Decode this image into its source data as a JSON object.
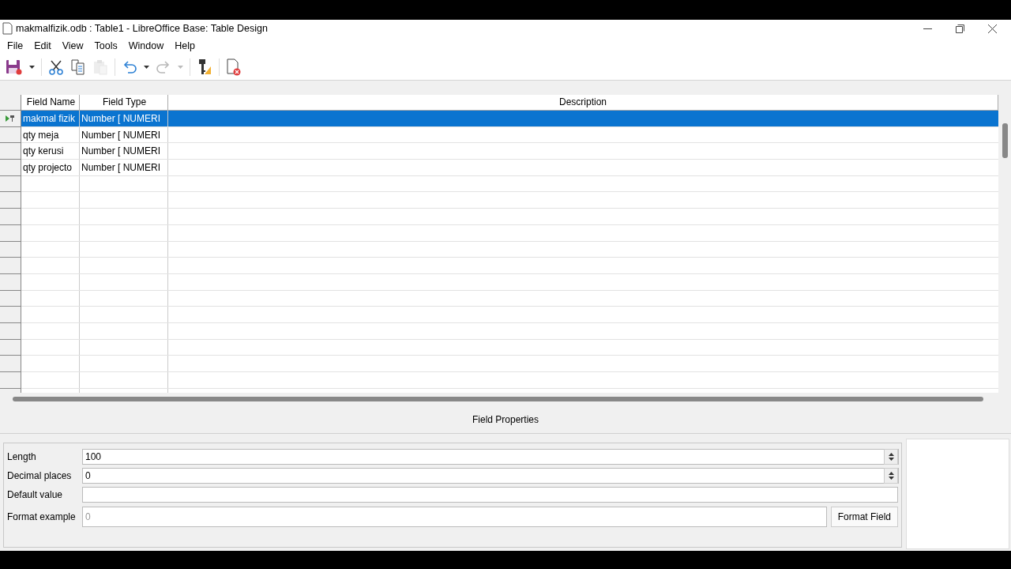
{
  "window": {
    "title": "makmalfizik.odb : Table1 - LibreOffice Base: Table Design"
  },
  "menu": [
    "File",
    "Edit",
    "View",
    "Tools",
    "Window",
    "Help"
  ],
  "toolbar": [
    {
      "kind": "save",
      "disabled": false,
      "dropdown": true
    },
    {
      "kind": "cut",
      "disabled": false,
      "dropdown": false
    },
    {
      "kind": "copy",
      "disabled": false,
      "dropdown": false
    },
    {
      "kind": "paste",
      "disabled": true,
      "dropdown": false
    },
    {
      "kind": "undo",
      "disabled": false,
      "dropdown": true
    },
    {
      "kind": "redo",
      "disabled": true,
      "dropdown": true
    },
    {
      "kind": "key",
      "disabled": false,
      "dropdown": false
    },
    {
      "kind": "close",
      "disabled": false,
      "dropdown": false
    }
  ],
  "table": {
    "columns": [
      "Field Name",
      "Field Type",
      "Description"
    ],
    "rows": [
      {
        "field_name": "makmal fizik",
        "field_type": "Number [ NUMERI",
        "selected": true,
        "primary_key": true
      },
      {
        "field_name": "qty meja",
        "field_type": "Number [ NUMERI",
        "selected": false,
        "primary_key": false
      },
      {
        "field_name": "qty kerusi",
        "field_type": "Number [ NUMERI",
        "selected": false,
        "primary_key": false
      },
      {
        "field_name": "qty projecto",
        "field_type": "Number [ NUMERI",
        "selected": false,
        "primary_key": false
      }
    ]
  },
  "field_properties": {
    "title": "Field Properties",
    "properties": [
      {
        "label": "Length",
        "value": "100",
        "kind": "spin"
      },
      {
        "label": "Decimal places",
        "value": "0",
        "kind": "spin"
      },
      {
        "label": "Default value",
        "kind": "text"
      },
      {
        "label": "Format example",
        "placeholder": "0",
        "kind": "example",
        "button": "Format Field"
      }
    ]
  }
}
